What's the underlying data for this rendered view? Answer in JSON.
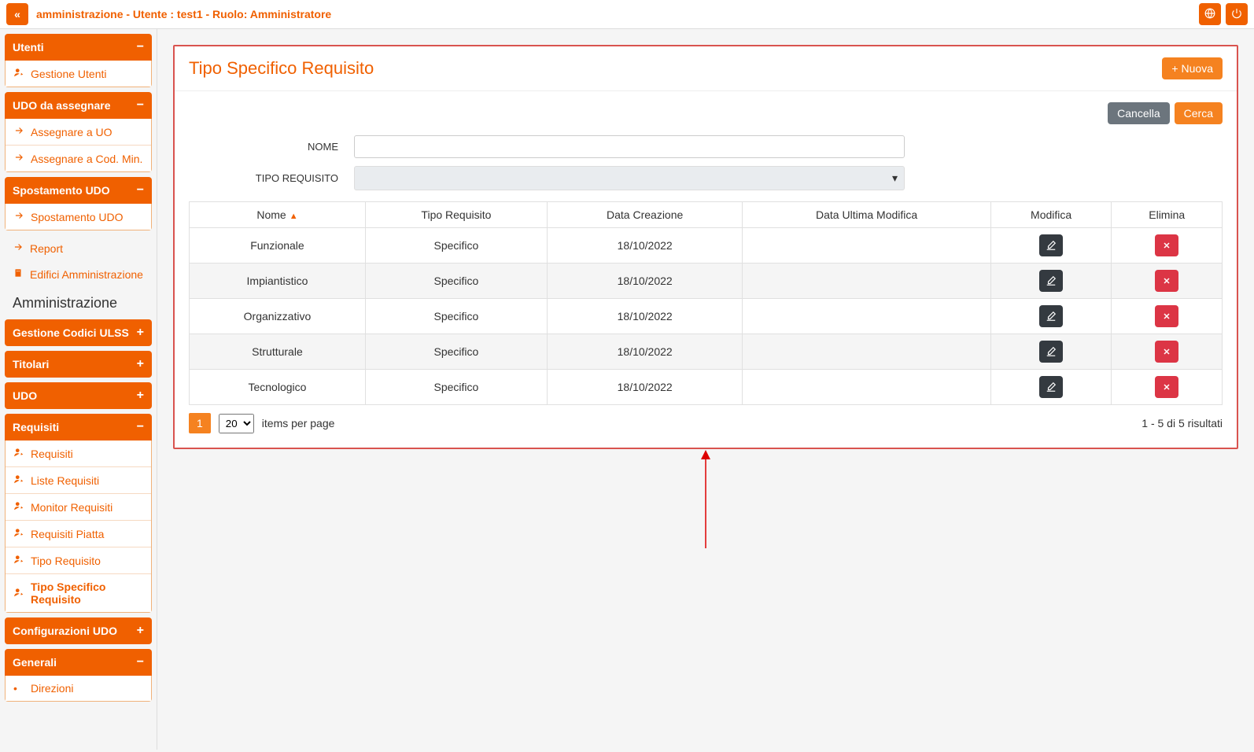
{
  "topbar": {
    "title": "amministrazione - Utente : test1 - Ruolo: Amministratore"
  },
  "sidebar": {
    "groups": [
      {
        "label": "Utenti",
        "toggle": "−",
        "open": true,
        "items": [
          {
            "label": "Gestione Utenti",
            "icon": "user-edit"
          }
        ]
      },
      {
        "label": "UDO da assegnare",
        "toggle": "−",
        "open": true,
        "items": [
          {
            "label": "Assegnare a UO",
            "icon": "arrow"
          },
          {
            "label": "Assegnare a Cod. Min.",
            "icon": "arrow"
          }
        ]
      },
      {
        "label": "Spostamento UDO",
        "toggle": "−",
        "open": true,
        "items": [
          {
            "label": "Spostamento UDO",
            "icon": "arrow"
          }
        ]
      }
    ],
    "standalone": [
      {
        "label": "Report",
        "icon": "arrow"
      },
      {
        "label": "Edifici Amministrazione",
        "icon": "building"
      }
    ],
    "section_label": "Amministrazione",
    "groups2": [
      {
        "label": "Gestione Codici ULSS",
        "toggle": "+",
        "open": false
      },
      {
        "label": "Titolari",
        "toggle": "+",
        "open": false
      },
      {
        "label": "UDO",
        "toggle": "+",
        "open": false
      },
      {
        "label": "Requisiti",
        "toggle": "−",
        "open": true,
        "items": [
          {
            "label": "Requisiti",
            "icon": "user-edit"
          },
          {
            "label": "Liste Requisiti",
            "icon": "user-edit"
          },
          {
            "label": "Monitor Requisiti",
            "icon": "user-edit"
          },
          {
            "label": "Requisiti Piatta",
            "icon": "user-edit"
          },
          {
            "label": "Tipo Requisito",
            "icon": "user-edit"
          },
          {
            "label": "Tipo Specifico Requisito",
            "icon": "user-edit",
            "active": true
          }
        ]
      },
      {
        "label": "Configurazioni UDO",
        "toggle": "+",
        "open": false
      },
      {
        "label": "Generali",
        "toggle": "−",
        "open": true,
        "items": [
          {
            "label": "Direzioni",
            "icon": "dot"
          }
        ]
      }
    ]
  },
  "main": {
    "card_title": "Tipo Specifico Requisito",
    "btn_new": "Nuova",
    "btn_cancel": "Cancella",
    "btn_search": "Cerca",
    "form": {
      "nome_label": "NOME",
      "tipo_label": "TIPO REQUISITO",
      "tipo_value": ""
    },
    "table": {
      "headers": [
        "Nome",
        "Tipo Requisito",
        "Data Creazione",
        "Data Ultima Modifica",
        "Modifica",
        "Elimina"
      ],
      "rows": [
        {
          "nome": "Funzionale",
          "tipo": "Specifico",
          "creazione": "18/10/2022",
          "modifica": ""
        },
        {
          "nome": "Impiantistico",
          "tipo": "Specifico",
          "creazione": "18/10/2022",
          "modifica": ""
        },
        {
          "nome": "Organizzativo",
          "tipo": "Specifico",
          "creazione": "18/10/2022",
          "modifica": ""
        },
        {
          "nome": "Strutturale",
          "tipo": "Specifico",
          "creazione": "18/10/2022",
          "modifica": ""
        },
        {
          "nome": "Tecnologico",
          "tipo": "Specifico",
          "creazione": "18/10/2022",
          "modifica": ""
        }
      ]
    },
    "pager": {
      "page": "1",
      "per_page": "20",
      "per_page_label": "items per page",
      "summary": "1 - 5 di 5 risultati"
    }
  }
}
